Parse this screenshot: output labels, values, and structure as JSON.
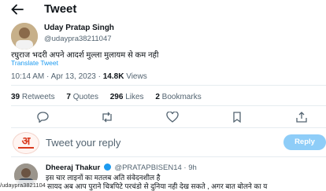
{
  "header": {
    "title": "Tweet",
    "back_icon": "back-arrow-icon"
  },
  "tweet": {
    "author_name": "Uday Pratap Singh",
    "author_handle": "@udaypra38211047",
    "text": "रघुराज भदरी अपने आदर्श मुल्ला मुलायम से कम नही",
    "translate": "Translate Tweet",
    "time": "10:14 AM · Apr 13, 2023 · ",
    "views_count": "14.8K",
    "views_label": " Views"
  },
  "stats": {
    "retweets_count": "39",
    "retweets_label": " Retweets",
    "quotes_count": "7",
    "quotes_label": " Quotes",
    "likes_count": "296",
    "likes_label": " Likes",
    "bookmarks_count": "2",
    "bookmarks_label": " Bookmarks"
  },
  "actions": [
    "reply-icon",
    "retweet-icon",
    "like-icon",
    "bookmark-icon",
    "share-icon"
  ],
  "reply_box": {
    "placeholder": "Tweet your reply",
    "button": "Reply"
  },
  "comment": {
    "name": "Dheeraj Thakur",
    "handle": "@PRATAPBISEN14 · 9h",
    "line1": "इस चार लाइनों का मतलब अति संवेदनशील है",
    "line2": "सायद अब आप पुराने चित्रपिटे परचंडो से दुनिया नही देख सकते , अगर बात बोलने का य"
  },
  "watermark": "/udaypra38211047",
  "colors": {
    "accent": "#1d9bf0",
    "reply_button": "#8ecdf8",
    "secondary_text": "#536471"
  }
}
